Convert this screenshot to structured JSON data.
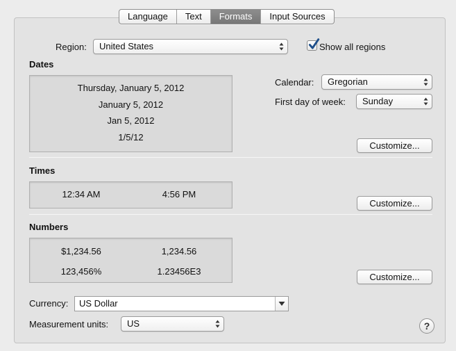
{
  "tabs": [
    {
      "label": "Language",
      "selected": false
    },
    {
      "label": "Text",
      "selected": false
    },
    {
      "label": "Formats",
      "selected": true
    },
    {
      "label": "Input Sources",
      "selected": false
    }
  ],
  "region": {
    "label": "Region:",
    "value": "United States"
  },
  "show_all_regions": {
    "label": "Show all regions",
    "checked": true
  },
  "dates": {
    "title": "Dates",
    "samples": [
      "Thursday, January 5, 2012",
      "January 5, 2012",
      "Jan 5, 2012",
      "1/5/12"
    ],
    "calendar": {
      "label": "Calendar:",
      "value": "Gregorian"
    },
    "first_day": {
      "label": "First day of week:",
      "value": "Sunday"
    },
    "customize_label": "Customize..."
  },
  "times": {
    "title": "Times",
    "short": "12:34 AM",
    "long": "4:56 PM",
    "customize_label": "Customize..."
  },
  "numbers": {
    "title": "Numbers",
    "currency": "$1,234.56",
    "decimal": "1,234.56",
    "percent": "123,456%",
    "scientific": "1.23456E3",
    "customize_label": "Customize..."
  },
  "currency": {
    "label": "Currency:",
    "value": "US Dollar"
  },
  "measurement": {
    "label": "Measurement units:",
    "value": "US"
  },
  "help": {
    "glyph": "?"
  },
  "colors": {
    "selected_tab": "#808080",
    "check_mark": "#1f4f8a"
  }
}
